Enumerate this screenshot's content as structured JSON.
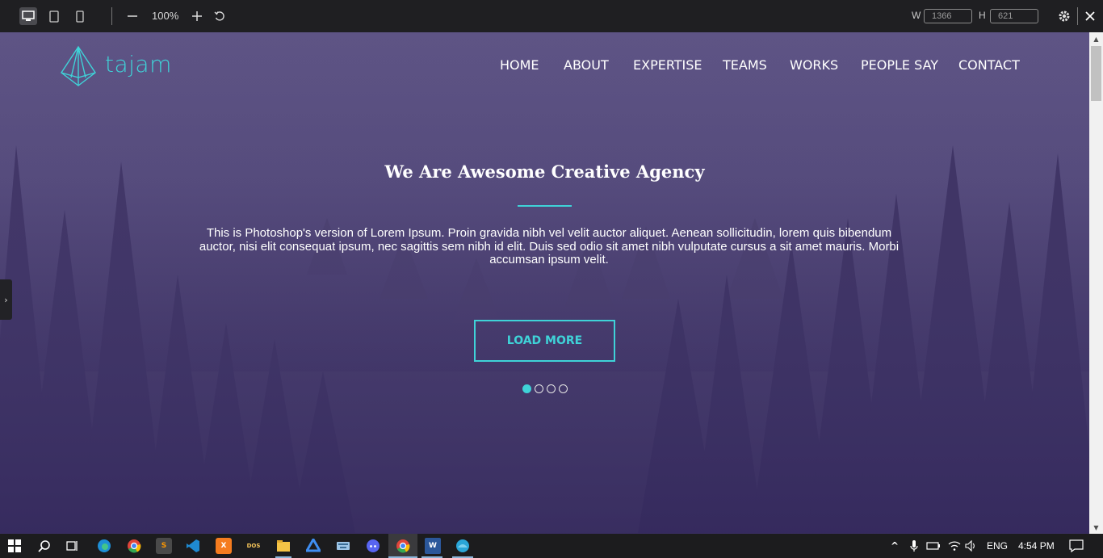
{
  "toolbar": {
    "zoom_level": "100%",
    "width_label": "W",
    "width_value": "1366",
    "height_label": "H",
    "height_value": "621",
    "icons": [
      "desktop-icon",
      "tablet-icon",
      "mobile-icon",
      "zoom-out-icon",
      "zoom-in-icon",
      "rotate-icon",
      "gear-icon",
      "close-icon"
    ]
  },
  "site": {
    "logo_text": "tajam",
    "nav": [
      "HOME",
      "ABOUT",
      "EXPERTISE",
      "TEAMS",
      "WORKS",
      "PEOPLE SAY",
      "CONTACT"
    ],
    "hero": {
      "title": "We Are Awesome Creative Agency",
      "description": "This is Photoshop's version of Lorem Ipsum. Proin gravida nibh vel velit auctor aliquet. Aenean sollicitudin, lorem quis bibendum auctor, nisi elit consequat ipsum, nec sagittis sem nibh id elit. Duis sed odio sit amet nibh vulputate cursus a sit amet mauris. Morbi accumsan ipsum velit.",
      "button_label": "LOAD MORE",
      "slider_dots": 4,
      "active_dot": 1
    },
    "colors": {
      "accent": "#3fd3d8",
      "overlay": "#4a3f70"
    }
  },
  "taskbar": {
    "language": "ENG",
    "time": "4:54 PM",
    "app_icons": [
      "windows-start-icon",
      "search-icon",
      "task-view-icon",
      "edge-icon",
      "chrome-icon",
      "sublime-icon",
      "vscode-icon",
      "xampp-icon",
      "dosbox-icon",
      "file-explorer-icon",
      "app-icon",
      "keyboard-icon",
      "discord-icon",
      "chrome-icon",
      "word-icon",
      "app-icon"
    ]
  }
}
